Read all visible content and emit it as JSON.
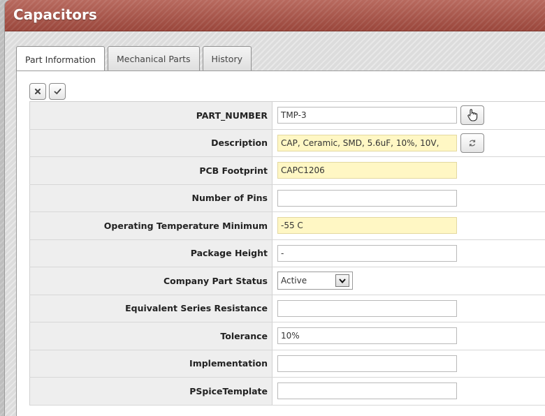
{
  "window": {
    "title": "Capacitors"
  },
  "tabs": [
    {
      "label": "Part Information"
    },
    {
      "label": "Mechanical Parts"
    },
    {
      "label": "History"
    }
  ],
  "toolbar": {
    "cancel_icon": "close-icon",
    "save_icon": "check-icon"
  },
  "form": {
    "rows": [
      {
        "label": "PART_NUMBER",
        "value": "TMP-3",
        "highlight": false
      },
      {
        "label": "Description",
        "value": "CAP, Ceramic, SMD, 5.6uF, 10%, 10V,",
        "highlight": true
      },
      {
        "label": "PCB Footprint",
        "value": "CAPC1206",
        "highlight": true
      },
      {
        "label": "Number of Pins",
        "value": "",
        "highlight": false
      },
      {
        "label": "Operating Temperature Minimum",
        "value": "-55 C",
        "highlight": true
      },
      {
        "label": "Package Height",
        "value": "-",
        "highlight": false
      },
      {
        "label": "Company Part Status",
        "value": "Active",
        "type": "select"
      },
      {
        "label": "Equivalent Series Resistance",
        "value": "",
        "highlight": false
      },
      {
        "label": "Tolerance",
        "value": "10%",
        "highlight": false
      },
      {
        "label": "Implementation",
        "value": "",
        "highlight": false
      },
      {
        "label": "PSpiceTemplate",
        "value": "",
        "highlight": false
      }
    ]
  },
  "colors": {
    "titlebar": "#a5554a",
    "highlight_field": "#fff7c4"
  }
}
